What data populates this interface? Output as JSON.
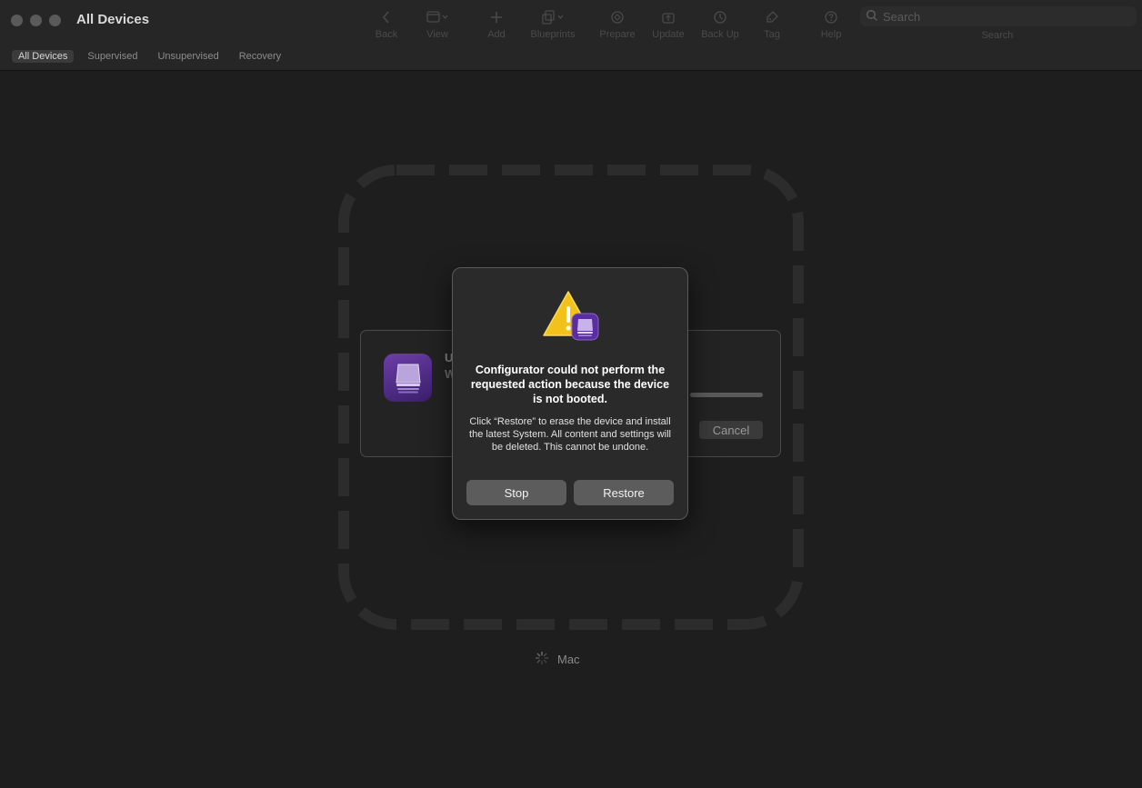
{
  "window": {
    "title": "All Devices"
  },
  "toolbar": {
    "back": "Back",
    "view": "View",
    "add": "Add",
    "blueprints": "Blueprints",
    "prepare": "Prepare",
    "update": "Update",
    "backup": "Back Up",
    "tag": "Tag",
    "help": "Help",
    "search_placeholder": "Search",
    "search_label": "Search"
  },
  "tabs": [
    "All Devices",
    "Supervised",
    "Unsupervised",
    "Recovery"
  ],
  "active_tab": "All Devices",
  "device": {
    "label": "Mac"
  },
  "progress_sheet": {
    "line1": "U",
    "line2": "W",
    "cancel_label": "Cancel"
  },
  "alert": {
    "title": "Configurator could not perform the requested action because the device is not booted.",
    "message": "Click “Restore” to erase the device and install the latest System. All content and settings will be deleted. This cannot be undone.",
    "stop_label": "Stop",
    "restore_label": "Restore"
  },
  "colors": {
    "background": "#1e1e1e",
    "toolbar": "#262626",
    "alert_bg": "#2a2a2a",
    "button": "#5c5c5c",
    "warning": "#f2c21b",
    "app_purple": "#6c3ea8"
  }
}
